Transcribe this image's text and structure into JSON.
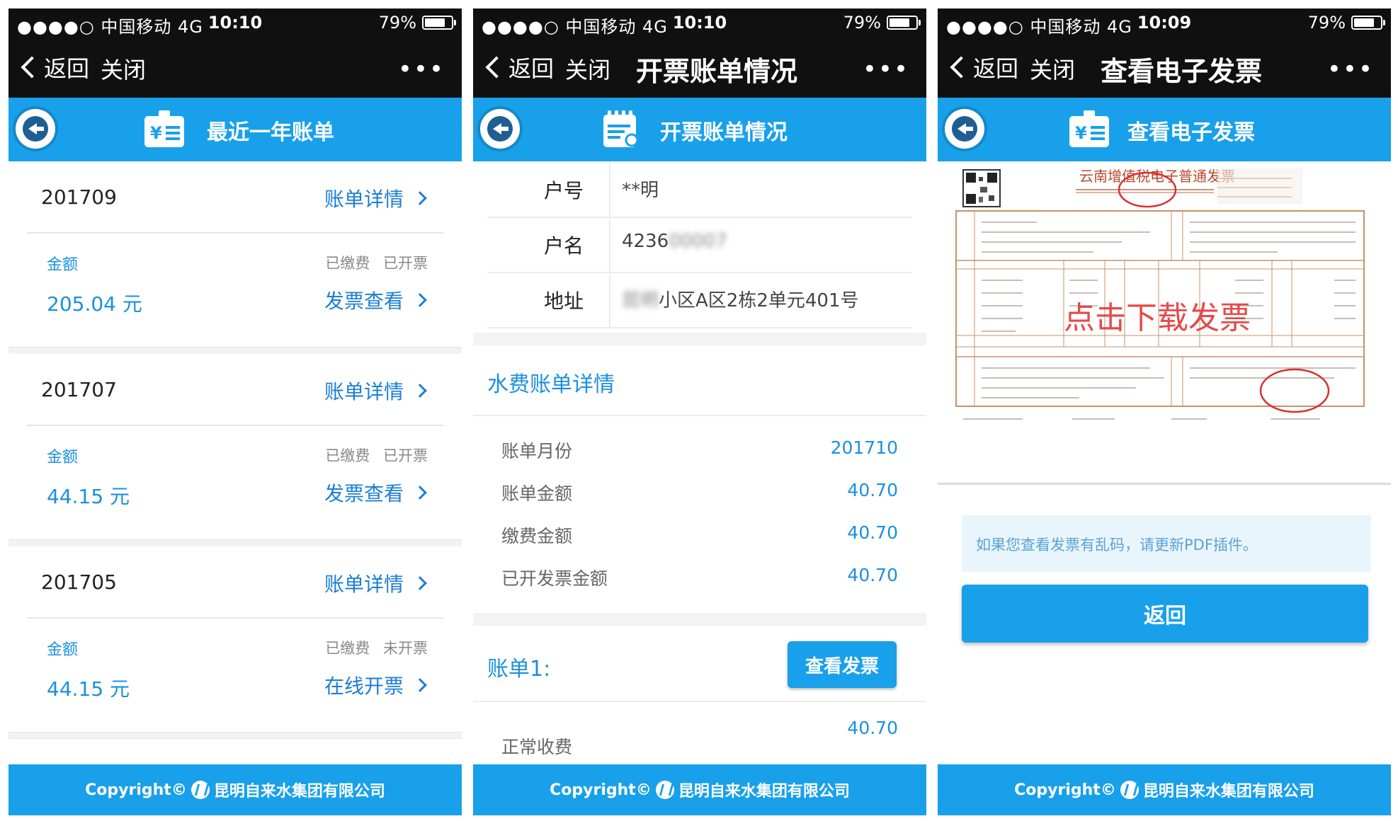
{
  "status": {
    "carrier": "●●●●○ 中国移动  4G",
    "battery": "79%",
    "battery_level": 0.79,
    "time_p1": "10:10",
    "time_p2": "10:10",
    "time_p3": "10:09"
  },
  "nav": {
    "back": "返回",
    "close": "关闭",
    "more": "•••",
    "title_p2": "开票账单情况",
    "title_p3": "查看电子发票"
  },
  "panel1": {
    "header_title": "最近一年账单",
    "bills": [
      {
        "month": "201709",
        "detail": "账单详情",
        "amount_label": "金额",
        "status": "已缴费 已开票",
        "amount": "205.04 元",
        "action": "发票查看"
      },
      {
        "month": "201707",
        "detail": "账单详情",
        "amount_label": "金额",
        "status": "已缴费 已开票",
        "amount": "44.15 元",
        "action": "发票查看"
      },
      {
        "month": "201705",
        "detail": "账单详情",
        "amount_label": "金额",
        "status": "已缴费 未开票",
        "amount": "44.15 元",
        "action": "在线开票"
      }
    ]
  },
  "panel2": {
    "header_title": "开票账单情况",
    "info": [
      {
        "label": "户号",
        "value": "**明",
        "blur": ""
      },
      {
        "label": "户名",
        "value": "4236",
        "blur": "00007"
      },
      {
        "label": "地址",
        "value": "小区A区2栋2单元401号",
        "blur": "昆明"
      }
    ],
    "section_title": "水费账单详情",
    "details": [
      {
        "key": "账单月份",
        "value": "201710"
      },
      {
        "key": "账单金额",
        "value": "40.70"
      },
      {
        "key": "缴费金额",
        "value": "40.70"
      },
      {
        "key": "已开发票金额",
        "value": "40.70"
      }
    ],
    "bill_label": "账单1:",
    "view_invoice": "查看发票",
    "normal_fee_label": "正常收费",
    "normal_fee_value": "40.70"
  },
  "panel3": {
    "header_title": "查看电子发票",
    "invoice_title": "云南增值税电子普通发票",
    "download_overlay": "点击下载发票",
    "notice": "如果您查看发票有乱码，请更新PDF插件。",
    "return": "返回"
  },
  "footer": {
    "copyright": "Copyright©",
    "company": "昆明自来水集团有限公司"
  },
  "colors": {
    "blue": "#19a0ea",
    "link": "#1b7ed6",
    "dark": "#101010"
  }
}
